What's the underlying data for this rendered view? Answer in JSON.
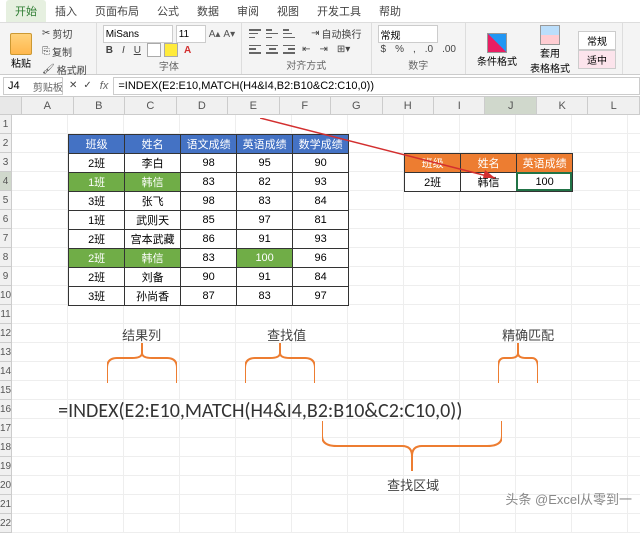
{
  "tabs": [
    "开始",
    "插入",
    "页面布局",
    "公式",
    "数据",
    "审阅",
    "视图",
    "开发工具",
    "帮助"
  ],
  "clipboard": {
    "paste": "粘贴",
    "cut": "剪切",
    "copy": "复制",
    "fmtpainter": "格式刷",
    "label": "剪贴板"
  },
  "font": {
    "name": "MiSans",
    "size": "11",
    "label": "字体"
  },
  "align": {
    "wrap": "自动换行",
    "label": "对齐方式"
  },
  "number": {
    "fmt": "常规",
    "label": "数字"
  },
  "styles": {
    "cond": "条件格式",
    "tbl": "套用\n表格格式"
  },
  "state": {
    "norm": "常规",
    "sel": "适中"
  },
  "namebox": "J4",
  "fx_icons": "✕ ✓",
  "formula": "=INDEX(E2:E10,MATCH(H4&I4,B2:B10&C2:C10,0))",
  "colheads": [
    "A",
    "B",
    "C",
    "D",
    "E",
    "F",
    "G",
    "H",
    "I",
    "J",
    "K",
    "L"
  ],
  "rowcount": 22,
  "table1": {
    "headers": [
      "班级",
      "姓名",
      "语文成绩",
      "英语成绩",
      "数学成绩"
    ],
    "rows": [
      [
        "2班",
        "李白",
        "98",
        "95",
        "90"
      ],
      [
        "1班",
        "韩信",
        "83",
        "82",
        "93"
      ],
      [
        "3班",
        "张飞",
        "98",
        "83",
        "84"
      ],
      [
        "1班",
        "武则天",
        "85",
        "97",
        "81"
      ],
      [
        "2班",
        "宫本武藏",
        "86",
        "91",
        "93"
      ],
      [
        "2班",
        "韩信",
        "83",
        "100",
        "96"
      ],
      [
        "2班",
        "刘备",
        "90",
        "91",
        "84"
      ],
      [
        "3班",
        "孙尚香",
        "87",
        "83",
        "97"
      ]
    ],
    "hl_col0_rows": [
      1,
      5
    ]
  },
  "table2": {
    "headers": [
      "班级",
      "姓名",
      "英语成绩"
    ],
    "rows": [
      [
        "2班",
        "韩信",
        "100"
      ]
    ]
  },
  "annotations": {
    "resultcol": "结果列",
    "lookupval": "查找值",
    "exact": "精确匹配",
    "lookuprange": "查找区域"
  },
  "bigformula": "=INDEX(E2:E10,MATCH(H4&I4,B2:B10&C2:C10,0))",
  "watermark": "头条 @Excel从零到一"
}
